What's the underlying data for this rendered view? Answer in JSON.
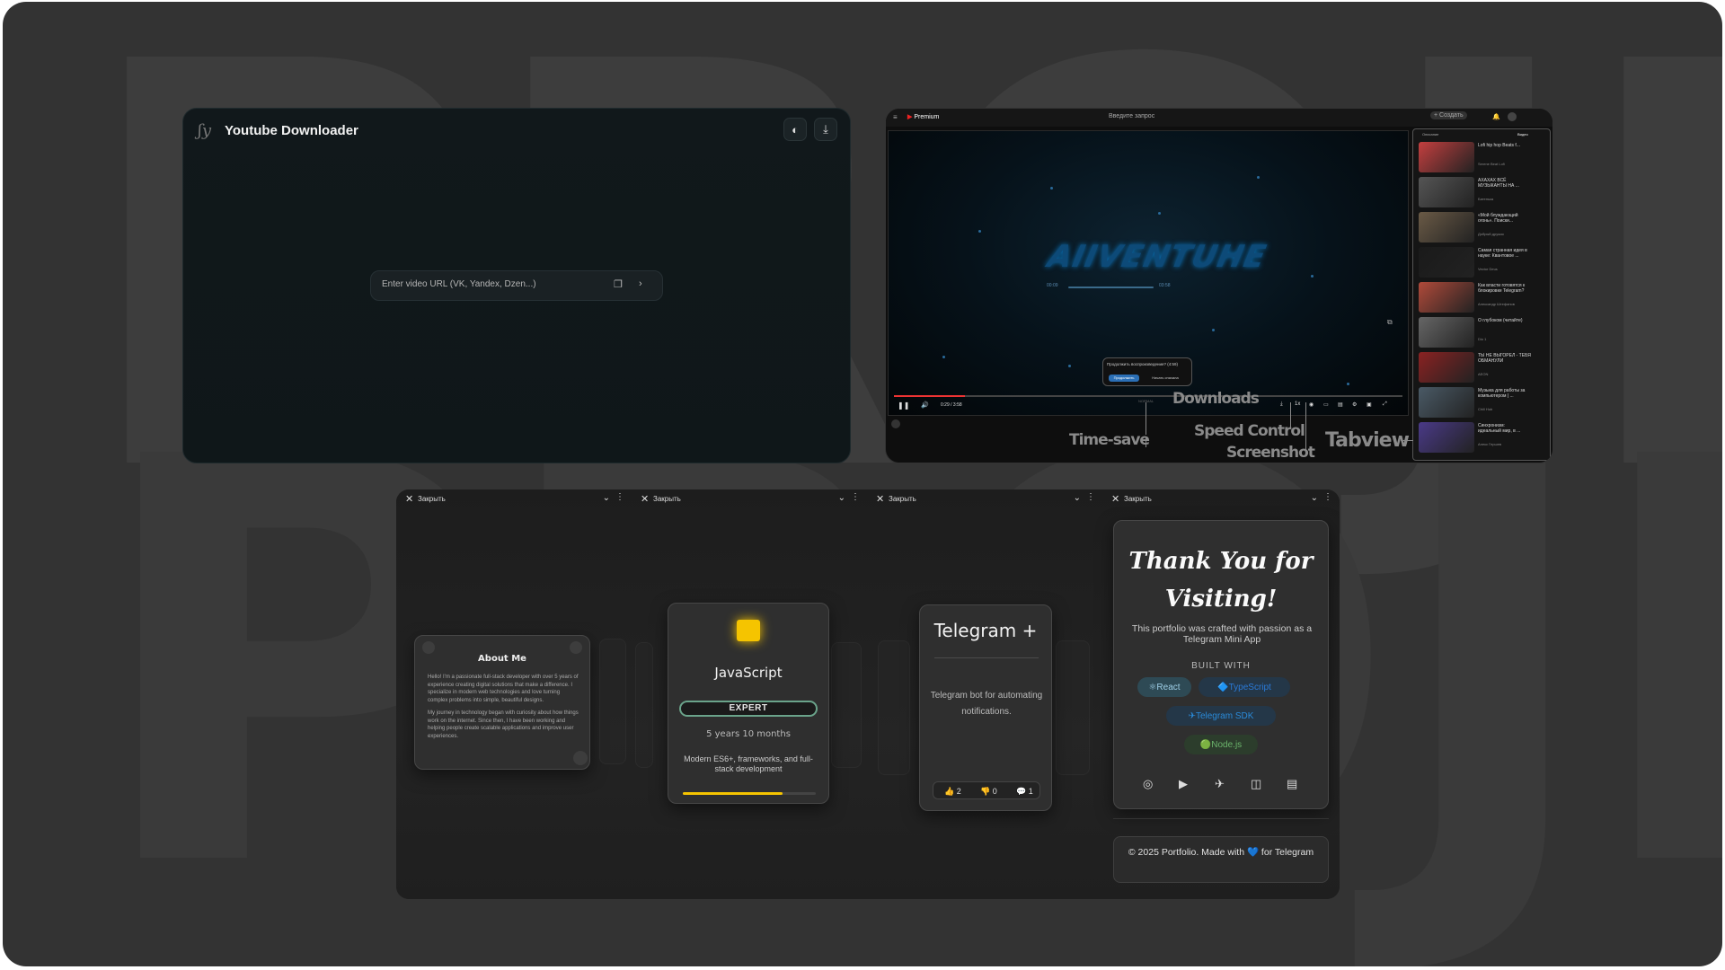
{
  "background_word": "PROJECTS",
  "downloader": {
    "title": "Youtube Downloader",
    "logo_icon": "signature-icon",
    "theme_icon": "theme-icon",
    "download_icon": "download-icon",
    "url_placeholder": "Enter video URL (VK, Yandex, Dzen...)",
    "paste_icon": "paste-icon",
    "go_icon": "chevron-right-icon"
  },
  "youtube": {
    "brand": "Premium",
    "search_placeholder": "Введите запрос",
    "create_label": "+ Создать",
    "player_logo": "AIIVENTUHE",
    "mini_time_start": "00:09",
    "mini_time_end": "03:58",
    "prompt_text": "Продолжить воспроизведение? (4:59)",
    "prompt_continue": "Продолжить",
    "prompt_restart": "Начать сначала",
    "time_display": "0:29 / 3:58",
    "quality_label": "NORMAL",
    "sidebar_tabs": [
      "Описание",
      "Видео"
    ],
    "sidebar_videos": [
      {
        "title": "Lofi hip hop Beats f...",
        "meta": "Serene Beat Lofi",
        "color": "#c43f3f"
      },
      {
        "title": "АХАХАХ ВСЁ\nМУЗЫКАНТЫ НА ...",
        "meta": "Батенька",
        "color": "#555"
      },
      {
        "title": "«Мой блуждающий\nогонь». Поиски...",
        "meta": "Добрый дружок",
        "color": "#6a5a46"
      },
      {
        "title": "Самая странная идея в\nнауке: Квантовое ...",
        "meta": "Vector Deus",
        "color": "#1a1a1a"
      },
      {
        "title": "Как власти готовятся к\nблокировке Telegram?",
        "meta": "Александр Штефанов",
        "color": "#b04a3a"
      },
      {
        "title": "О глубоком (читайте)",
        "meta": "Dio 1",
        "color": "#666"
      },
      {
        "title": "ТЫ НЕ ВЫГОРЕЛ - ТЕБЯ\nОБМАНУЛИ",
        "meta": "AEON",
        "color": "#8a2222"
      },
      {
        "title": "Музыка для работы за\nкомпьютером | ...",
        "meta": "Chill Hub",
        "color": "#4a5a66"
      },
      {
        "title": "Синхронизм:\nидеальный мир, в ...",
        "meta": "Алекс Гершев",
        "color": "#4a3a88"
      }
    ]
  },
  "annotations": {
    "downloads": "Downloads",
    "time_save": "Time-save",
    "speed_control": "Speed Control",
    "screenshot": "Screenshot",
    "tabview": "Tabview"
  },
  "telegram_app": {
    "close_label": "Закрыть",
    "about": {
      "title": "About Me",
      "p1": "Hello! I'm a passionate full-stack developer with over 5 years of experience creating digital solutions that make a difference. I specialize in modern web technologies and love turning complex problems into simple, beautiful designs.",
      "p2": "My journey in technology began with curiosity about how things work on the internet. Since then, I have been working and helping people create scalable applications and improve user experiences."
    },
    "skill": {
      "name": "JavaScript",
      "level": "EXPERT",
      "duration": "5 years 10 months",
      "description": "Modern ES6+, frameworks, and full-stack development",
      "progress": 0.75,
      "accent": "#f5c400"
    },
    "project": {
      "name": "Telegram +",
      "description": "Telegram bot for automating notifications.",
      "likes": "👍 2",
      "dislikes": "👎 0",
      "comments": "💬 1"
    },
    "thanks": {
      "heading_line1": "Thank You for",
      "heading_line2": "Visiting!",
      "subtitle": "This portfolio was crafted with passion as a Telegram Mini App",
      "built_with": "BUILT WITH",
      "chips": [
        {
          "label": "⚛React",
          "color": "#9fd0e8",
          "bg": "#2e4a55"
        },
        {
          "label": "🔷TypeScript",
          "color": "#2a7ad8",
          "bg": "#243748"
        },
        {
          "label": "✈Telegram SDK",
          "color": "#2a8ad8",
          "bg": "#243748"
        },
        {
          "label": "🟢Node.js",
          "color": "#6bb46b",
          "bg": "#2c3d2c"
        }
      ],
      "social_icons": [
        "github-icon",
        "youtube-icon",
        "telegram-icon",
        "instagram-icon",
        "resume-icon"
      ]
    },
    "footer": "© 2025 Portfolio. Made with 💙 for Telegram"
  }
}
